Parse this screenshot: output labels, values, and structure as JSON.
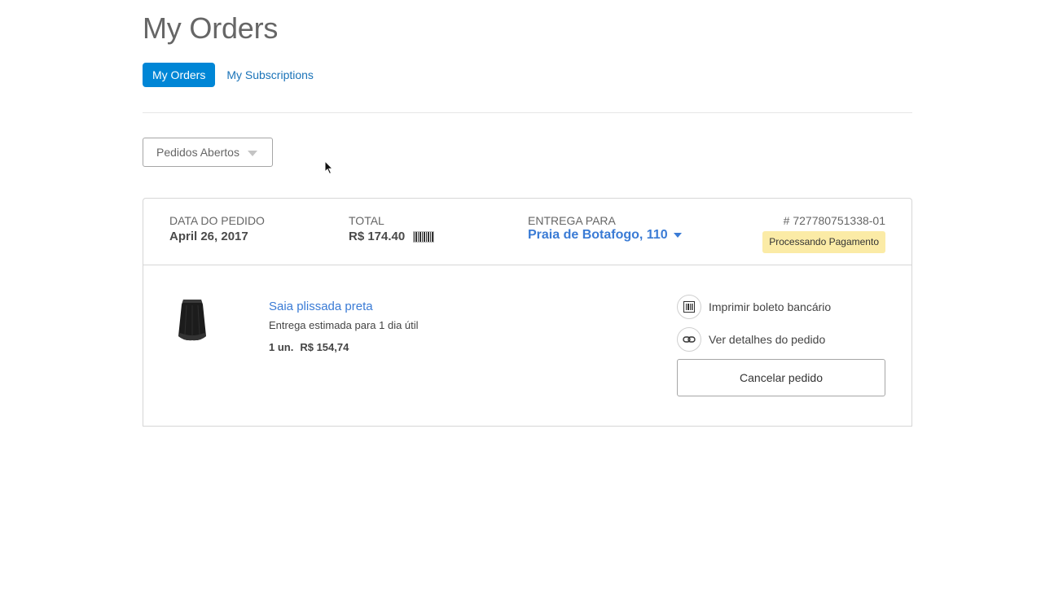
{
  "header": {
    "title": "My Orders",
    "tabs": [
      {
        "label": "My Orders",
        "active": true
      },
      {
        "label": "My Subscriptions",
        "active": false
      }
    ]
  },
  "filter": {
    "selected": "Pedidos Abertos"
  },
  "order": {
    "date_label": "DATA DO PEDIDO",
    "date_value": "April 26, 2017",
    "total_label": "TOTAL",
    "total_value": "R$ 174.40",
    "delivery_label": "ENTREGA PARA",
    "delivery_value": "Praia de Botafogo, 110",
    "number": "# 727780751338-01",
    "status": "Processando Pagamento",
    "status_color": "#fbeba6",
    "item": {
      "name": "Saia plissada preta",
      "eta": "Entrega estimada para 1 dia útil",
      "quantity": "1 un.",
      "price": "R$ 154,74"
    },
    "actions": [
      {
        "label": "Imprimir boleto bancário",
        "icon": "barcode-icon"
      },
      {
        "label": "Ver detalhes do pedido",
        "icon": "link-icon"
      }
    ],
    "cancel_label": "Cancelar pedido"
  },
  "colors": {
    "accent": "#0086d6",
    "link": "#3a7bd5"
  }
}
